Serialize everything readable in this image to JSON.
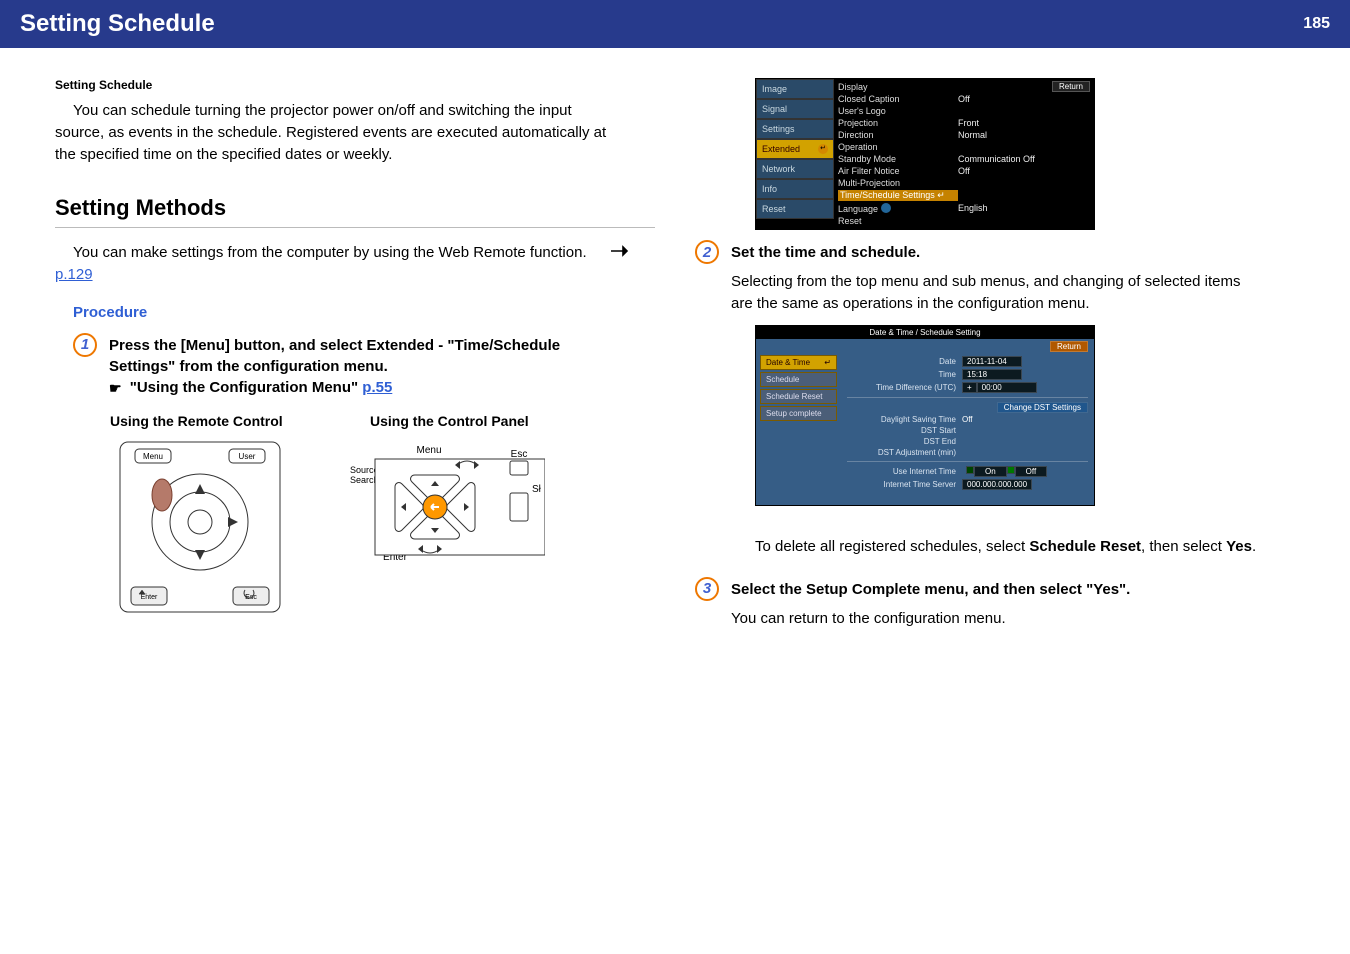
{
  "header": {
    "title": "Setting Schedule",
    "page": "185"
  },
  "breadcrumb": "Setting Schedule",
  "intro": "You can schedule turning the projector power on/off and switching the input source, as events in the schedule. Registered events are executed automatically at the specified time on the specified dates or weekly.",
  "section": {
    "title": "Setting Methods",
    "body_a": "You can make settings from the computer by using the Web Remote function. ",
    "body_link": "p.129"
  },
  "procedure_label": "Procedure",
  "step1": {
    "num": "1",
    "line1": "Press the [Menu] button, and select Extended - \"Time/Schedule Settings\" from the configuration menu.",
    "line2a": "\"Using the Configuration Menu\" ",
    "line2_link": "p.55",
    "sub_left": "Using the Remote Control",
    "sub_right": "Using the Control Panel"
  },
  "remote_labels": {
    "menu": "Menu",
    "user": "User",
    "enter": "Enter",
    "esc": "Esc"
  },
  "panel_labels": {
    "menu": "Menu",
    "esc": "Esc",
    "enter": "Enter",
    "source": "Source\nSearch"
  },
  "menu1": {
    "sidebar": [
      "Image",
      "Signal",
      "Settings",
      "Extended",
      "Network",
      "Info",
      "Reset"
    ],
    "return": "Return",
    "items": [
      {
        "k": "Display",
        "v": ""
      },
      {
        "k": "Closed Caption",
        "v": "Off"
      },
      {
        "k": "User's Logo",
        "v": ""
      },
      {
        "k": "Projection",
        "v": "Front"
      },
      {
        "k": "Direction",
        "v": "Normal"
      },
      {
        "k": "Operation",
        "v": ""
      },
      {
        "k": "Standby Mode",
        "v": "Communication Off"
      },
      {
        "k": "Air Filter Notice",
        "v": "Off"
      },
      {
        "k": "Multi-Projection",
        "v": ""
      },
      {
        "k": "Time/Schedule Settings",
        "v": "",
        "hl": true
      },
      {
        "k": "Language",
        "v": "English",
        "lang": true
      },
      {
        "k": "Reset",
        "v": ""
      }
    ]
  },
  "step2": {
    "num": "2",
    "title": "Set the time and schedule.",
    "body": "Selecting from the top menu and sub menus, and changing of selected items are the same as operations in the configuration menu."
  },
  "shot2": {
    "title": "Date & Time / Schedule Setting",
    "return": "Return",
    "tabs": [
      "Date & Time",
      "Schedule",
      "Schedule Reset",
      "Setup complete"
    ],
    "rows": {
      "date_l": "Date",
      "date_v": "2011-11-04",
      "time_l": "Time",
      "time_v": "15:18",
      "tdiff_l": "Time Difference (UTC)",
      "tdiff_v": "00:00",
      "change_btn": "Change DST Settings",
      "dst_l": "Daylight Saving Time",
      "dst_v": "Off",
      "dsts_l": "DST Start",
      "dste_l": "DST End",
      "dstadj_l": "DST Adjustment (min)",
      "uit_l": "Use Internet Time",
      "on": "On",
      "off": "Off",
      "its_l": "Internet Time Server",
      "its_v": "000.000.000.000"
    }
  },
  "after_shot2_a": "To delete all registered schedules, select ",
  "after_shot2_b": "Schedule Reset",
  "after_shot2_c": ", then select ",
  "after_shot2_d": "Yes",
  "after_shot2_e": ".",
  "step3": {
    "num": "3",
    "title": "Select the Setup Complete menu, and then select \"Yes\".",
    "body": "You can return to the configuration menu."
  }
}
